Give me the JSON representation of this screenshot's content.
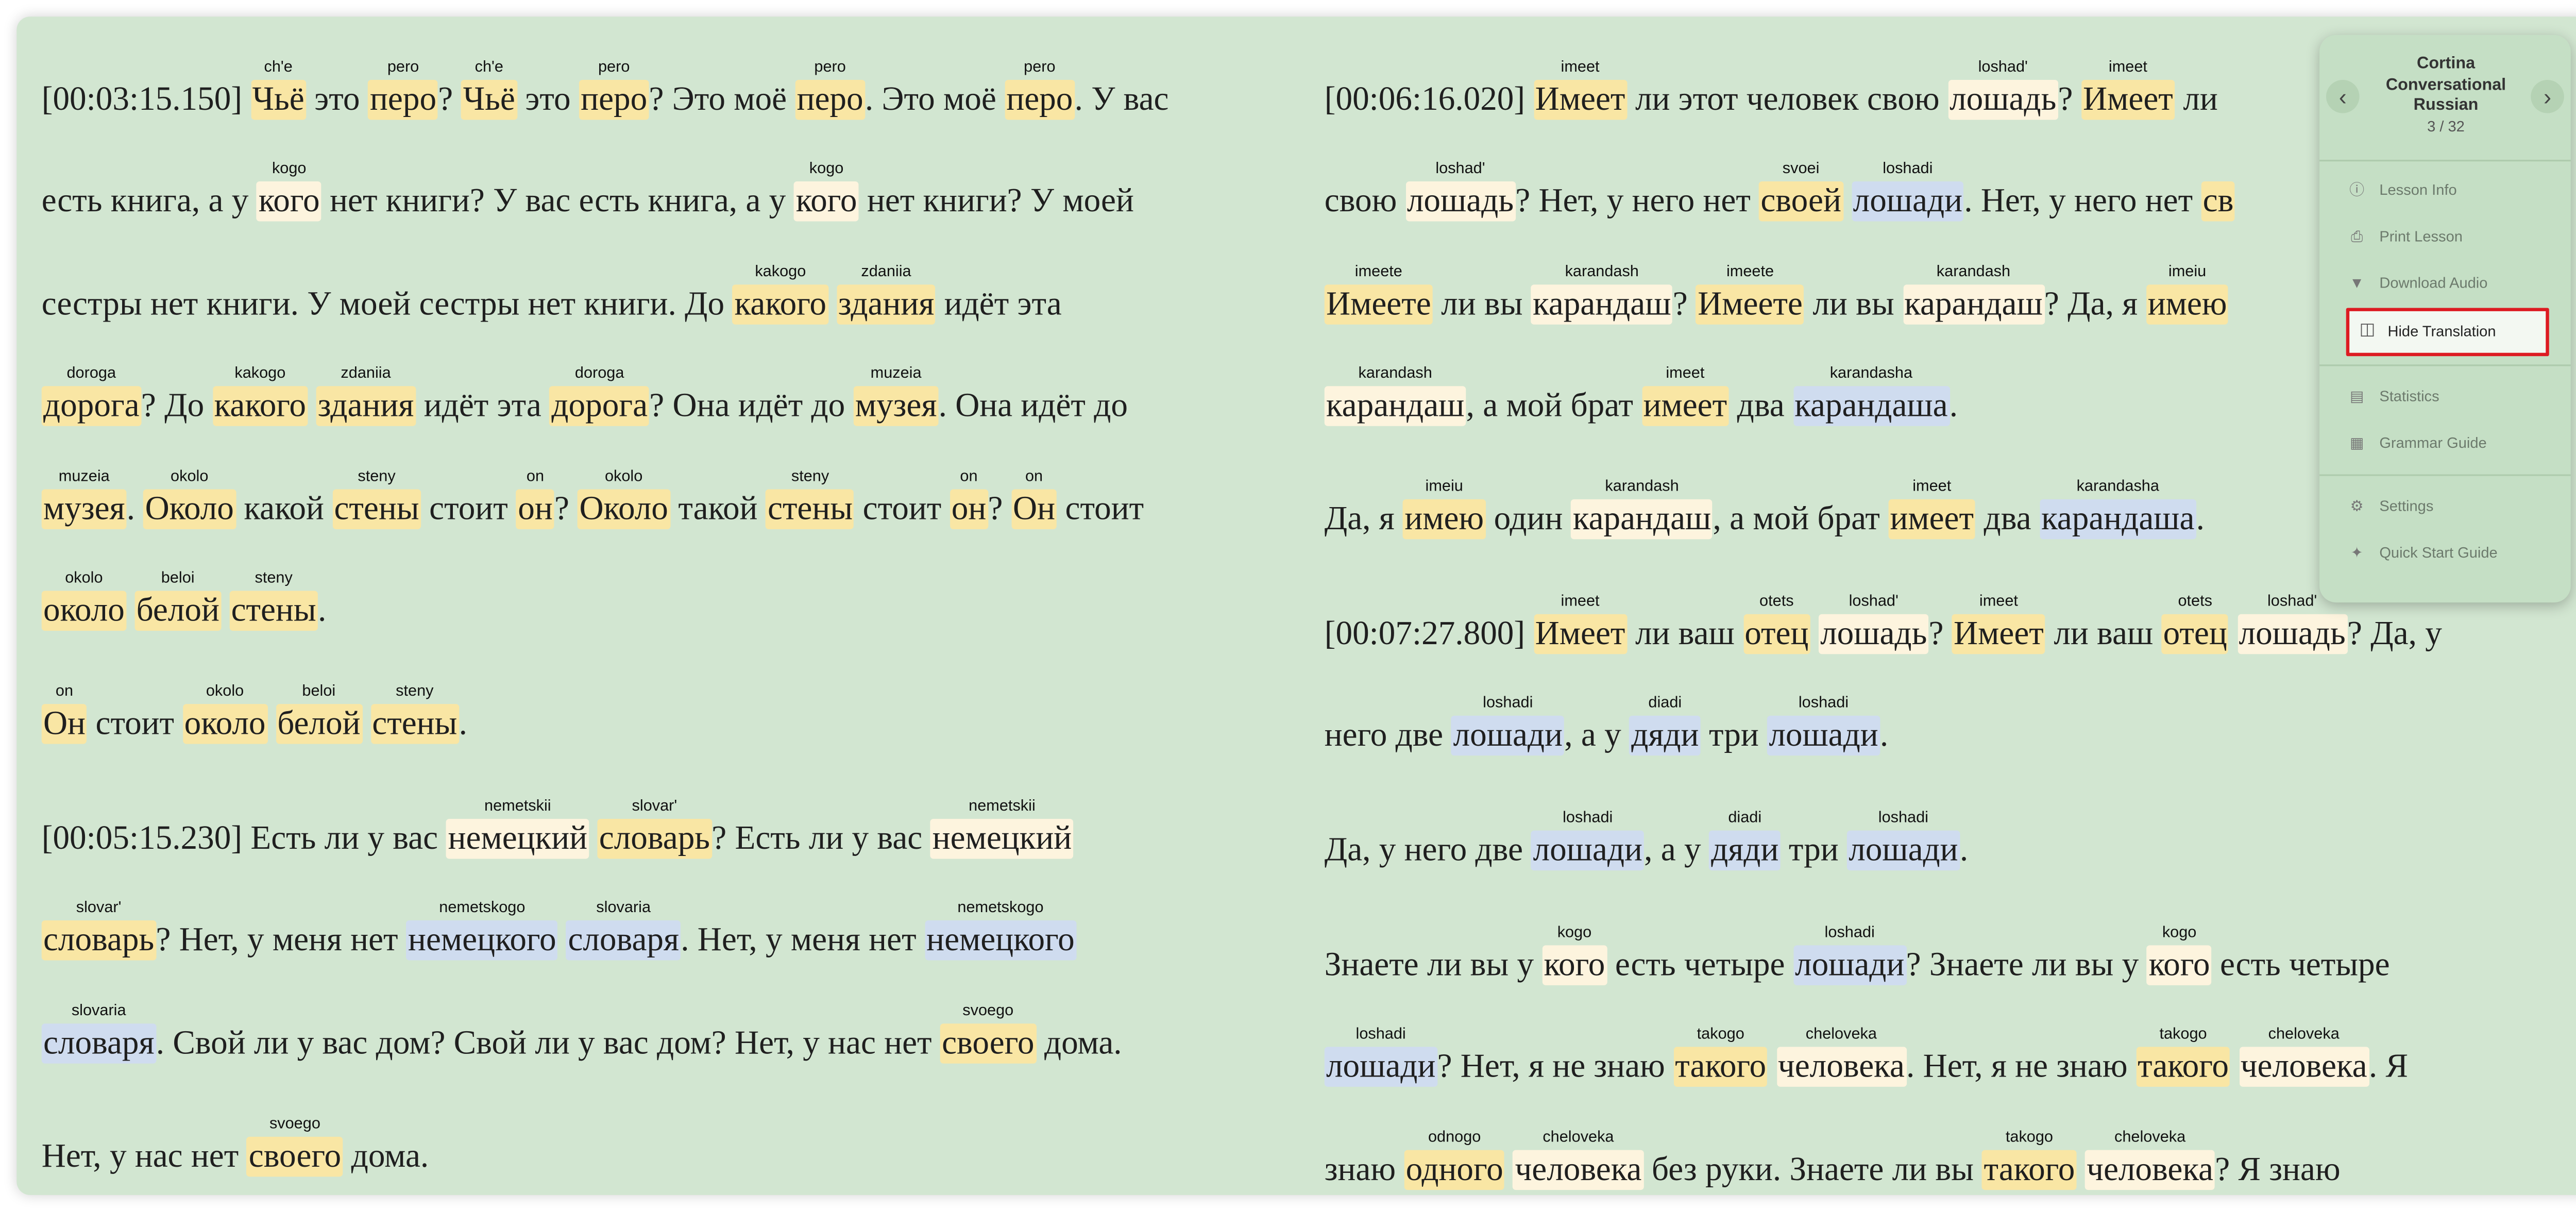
{
  "panel": {
    "title_lines": [
      "Cortina",
      "Conversational",
      "Russian"
    ],
    "lesson_count": "3 / 32",
    "prev_icon": "chevron-left-icon",
    "next_icon": "chevron-right-icon",
    "menu": [
      {
        "label": "Lesson Info",
        "icon": "info-icon"
      },
      {
        "label": "Print Lesson",
        "icon": "print-icon"
      },
      {
        "label": "Download Audio",
        "icon": "download-icon"
      },
      {
        "label": "Hide Translation",
        "icon": "translate-icon",
        "highlighted": true
      },
      {
        "label": "Statistics",
        "icon": "chart-icon"
      },
      {
        "label": "Grammar Guide",
        "icon": "book-icon"
      },
      {
        "label": "Settings",
        "icon": "gear-icon"
      },
      {
        "label": "Quick Start Guide",
        "icon": "rocket-icon"
      }
    ]
  },
  "highlight_colors": {
    "y": "#f9e6a4",
    "c": "#fdf4de",
    "b": "#cfdcef"
  },
  "left": [
    [
      [
        [
          "[00:03:15.150] "
        ],
        [
          "Чьё",
          "ch'e",
          "y"
        ],
        [
          " это "
        ],
        [
          "перо",
          "pero",
          "y"
        ],
        [
          "? "
        ],
        [
          "Чьё",
          "ch'e",
          "y"
        ],
        [
          " это "
        ],
        [
          "перо",
          "pero",
          "y"
        ],
        [
          "? Это моё "
        ],
        [
          "перо",
          "pero",
          "y"
        ],
        [
          ". Это моё "
        ],
        [
          "перо",
          "pero",
          "y"
        ],
        [
          ". У вас"
        ]
      ],
      [
        [
          "есть книга, а у "
        ],
        [
          "кого",
          "kogo",
          "c"
        ],
        [
          " нет книги? У вас есть книга, а у "
        ],
        [
          "кого",
          "kogo",
          "c"
        ],
        [
          " нет книги? У моей"
        ]
      ],
      [
        [
          "сестры нет книги. У моей сестры нет книги. До "
        ],
        [
          "какого",
          "kakogo",
          "y"
        ],
        [
          " "
        ],
        [
          "здания",
          "zdaniia",
          "y"
        ],
        [
          " идёт эта"
        ]
      ],
      [
        [
          "дорога",
          "doroga",
          "y"
        ],
        [
          "? До "
        ],
        [
          "какого",
          "kakogo",
          "y"
        ],
        [
          " "
        ],
        [
          "здания",
          "zdaniia",
          "y"
        ],
        [
          " идёт эта "
        ],
        [
          "дорога",
          "doroga",
          "y"
        ],
        [
          "? Она идёт до "
        ],
        [
          "музея",
          "muzeia",
          "y"
        ],
        [
          ". Она идёт до"
        ]
      ],
      [
        [
          "музея",
          "muzeia",
          "y"
        ],
        [
          ". "
        ],
        [
          "Около",
          "okolo",
          "y"
        ],
        [
          " какой "
        ],
        [
          "стены",
          "steny",
          "y"
        ],
        [
          " стоит "
        ],
        [
          "он",
          "on",
          "y"
        ],
        [
          "? "
        ],
        [
          "Около",
          "okolo",
          "y"
        ],
        [
          " такой "
        ],
        [
          "стены",
          "steny",
          "y"
        ],
        [
          " стоит "
        ],
        [
          "он",
          "on",
          "y"
        ],
        [
          "? "
        ],
        [
          "Он",
          "on",
          "y"
        ],
        [
          " стоит"
        ]
      ],
      [
        [
          "около",
          "okolo",
          "y"
        ],
        [
          " "
        ],
        [
          "белой",
          "beloi",
          "y"
        ],
        [
          " "
        ],
        [
          "стены",
          "steny",
          "y"
        ],
        [
          "."
        ]
      ]
    ],
    [
      [
        [
          "Он",
          "on",
          "y"
        ],
        [
          " стоит "
        ],
        [
          "около",
          "okolo",
          "y"
        ],
        [
          " "
        ],
        [
          "белой",
          "beloi",
          "y"
        ],
        [
          " "
        ],
        [
          "стены",
          "steny",
          "y"
        ],
        [
          "."
        ]
      ]
    ],
    [
      [
        [
          "[00:05:15.230] Есть ли у вас "
        ],
        [
          "немецкий",
          "nemetskii",
          "c"
        ],
        [
          " "
        ],
        [
          "словарь",
          "slovar'",
          "y"
        ],
        [
          "? Есть ли у вас "
        ],
        [
          "немецкий",
          "nemetskii",
          "c"
        ]
      ],
      [
        [
          "словарь",
          "slovar'",
          "y"
        ],
        [
          "? Нет, у меня нет "
        ],
        [
          "немецкого",
          "nemetskogo",
          "b"
        ],
        [
          " "
        ],
        [
          "словаря",
          "slovaria",
          "b"
        ],
        [
          ". Нет, у меня нет "
        ],
        [
          "немецкого",
          "nemetskogo",
          "b"
        ]
      ],
      [
        [
          "словаря",
          "slovaria",
          "b"
        ],
        [
          ". Свой ли у вас дом? Свой ли у вас дом? Нет, у нас нет "
        ],
        [
          "своего",
          "svoego",
          "y"
        ],
        [
          " дома."
        ]
      ]
    ],
    [
      [
        [
          "Нет, у нас нет "
        ],
        [
          "своего",
          "svoego",
          "y"
        ],
        [
          " дома."
        ]
      ]
    ]
  ],
  "right": [
    [
      [
        [
          "[00:06:16.020] "
        ],
        [
          "Имеет",
          "imeet",
          "y"
        ],
        [
          " ли этот человек свою "
        ],
        [
          "лошадь",
          "loshad'",
          "c"
        ],
        [
          "? "
        ],
        [
          "Имеет",
          "imeet",
          "y"
        ],
        [
          " ли"
        ]
      ],
      [
        [
          "свою "
        ],
        [
          "лошадь",
          "loshad'",
          "c"
        ],
        [
          "? Нет, у него нет "
        ],
        [
          "своей",
          "svoei",
          "y"
        ],
        [
          " "
        ],
        [
          "лошади",
          "loshadi",
          "b"
        ],
        [
          ". Нет, у него нет "
        ],
        [
          "св",
          "",
          "y"
        ]
      ],
      [
        [
          "Имеете",
          "imeete",
          "y"
        ],
        [
          " ли вы "
        ],
        [
          "карандаш",
          "karandash",
          "c"
        ],
        [
          "? "
        ],
        [
          "Имеете",
          "imeete",
          "y"
        ],
        [
          " ли вы "
        ],
        [
          "карандаш",
          "karandash",
          "c"
        ],
        [
          "? Да, я "
        ],
        [
          "имею",
          "imeiu",
          "y"
        ]
      ],
      [
        [
          "карандаш",
          "karandash",
          "c"
        ],
        [
          ", а мой брат "
        ],
        [
          "имеет",
          "imeet",
          "y"
        ],
        [
          " два "
        ],
        [
          "карандаша",
          "karandasha",
          "b"
        ],
        [
          "."
        ]
      ]
    ],
    [
      [
        [
          "Да, я "
        ],
        [
          "имею",
          "imeiu",
          "y"
        ],
        [
          " один "
        ],
        [
          "карандаш",
          "karandash",
          "c"
        ],
        [
          ", а мой брат "
        ],
        [
          "имеет",
          "imeet",
          "y"
        ],
        [
          " два "
        ],
        [
          "карандаша",
          "karandasha",
          "b"
        ],
        [
          "."
        ]
      ]
    ],
    [
      [
        [
          "[00:07:27.800] "
        ],
        [
          "Имеет",
          "imeet",
          "y"
        ],
        [
          " ли ваш "
        ],
        [
          "отец",
          "otets",
          "y"
        ],
        [
          " "
        ],
        [
          "лошадь",
          "loshad'",
          "c"
        ],
        [
          "? "
        ],
        [
          "Имеет",
          "imeet",
          "y"
        ],
        [
          " ли ваш "
        ],
        [
          "отец",
          "otets",
          "y"
        ],
        [
          " "
        ],
        [
          "лошадь",
          "loshad'",
          "c"
        ],
        [
          "? Да, у"
        ]
      ],
      [
        [
          "него две "
        ],
        [
          "лошади",
          "loshadi",
          "b"
        ],
        [
          ", а у "
        ],
        [
          "дяди",
          "diadi",
          "b"
        ],
        [
          " три "
        ],
        [
          "лошади",
          "loshadi",
          "b"
        ],
        [
          "."
        ]
      ]
    ],
    [
      [
        [
          "Да, у него две "
        ],
        [
          "лошади",
          "loshadi",
          "b"
        ],
        [
          ", а у "
        ],
        [
          "дяди",
          "diadi",
          "b"
        ],
        [
          " три "
        ],
        [
          "лошади",
          "loshadi",
          "b"
        ],
        [
          "."
        ]
      ]
    ],
    [
      [
        [
          "Знаете ли вы у "
        ],
        [
          "кого",
          "kogo",
          "c"
        ],
        [
          " есть четыре "
        ],
        [
          "лошади",
          "loshadi",
          "b"
        ],
        [
          "? Знаете ли вы у "
        ],
        [
          "кого",
          "kogo",
          "c"
        ],
        [
          " есть четыре"
        ]
      ],
      [
        [
          "лошади",
          "loshadi",
          "b"
        ],
        [
          "? Нет, я не знаю "
        ],
        [
          "такого",
          "takogo",
          "y"
        ],
        [
          " "
        ],
        [
          "человека",
          "cheloveka",
          "c"
        ],
        [
          ". Нет, я не знаю "
        ],
        [
          "такого",
          "takogo",
          "y"
        ],
        [
          " "
        ],
        [
          "человека",
          "cheloveka",
          "c"
        ],
        [
          ". Я"
        ]
      ],
      [
        [
          "знаю "
        ],
        [
          "одного",
          "odnogo",
          "y"
        ],
        [
          " "
        ],
        [
          "человека",
          "cheloveka",
          "c"
        ],
        [
          " без руки. Знаете ли вы "
        ],
        [
          "такого",
          "takogo",
          "y"
        ],
        [
          " "
        ],
        [
          "человека",
          "cheloveka",
          "c"
        ],
        [
          "? Я знаю"
        ]
      ]
    ]
  ]
}
